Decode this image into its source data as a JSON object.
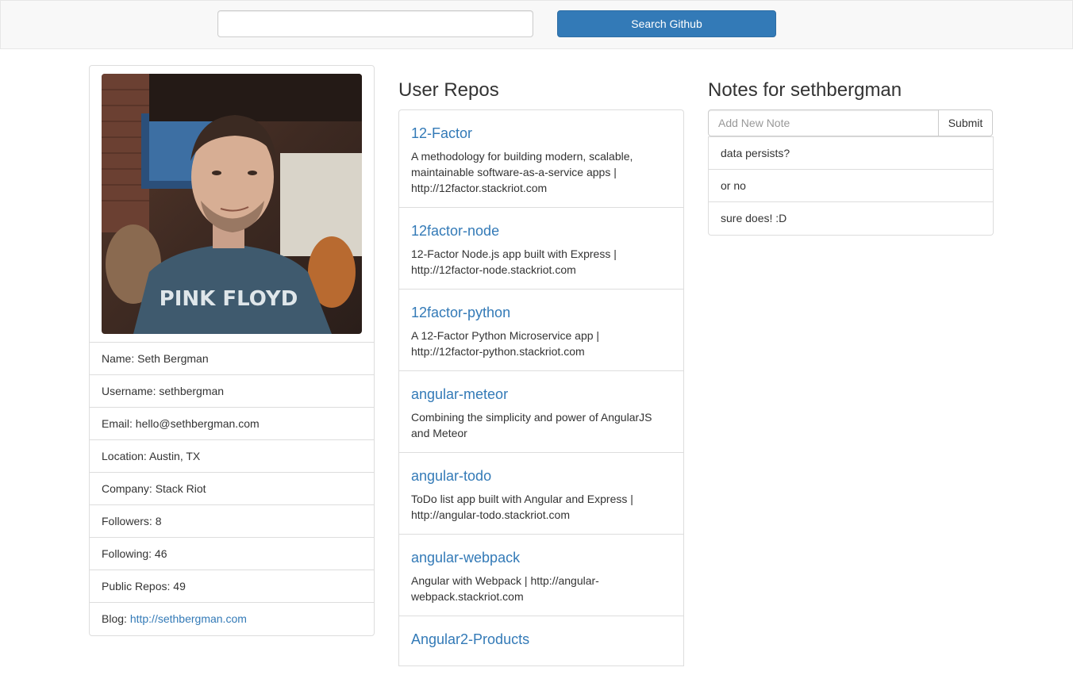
{
  "search": {
    "value": "",
    "placeholder": "",
    "button_label": "Search Github"
  },
  "profile": {
    "avatar_alt": "Seth Bergman avatar",
    "items": [
      {
        "label": "Name: ",
        "value": "Seth Bergman"
      },
      {
        "label": "Username: ",
        "value": "sethbergman"
      },
      {
        "label": "Email: ",
        "value": "hello@sethbergman.com"
      },
      {
        "label": "Location: ",
        "value": "Austin, TX"
      },
      {
        "label": "Company: ",
        "value": "Stack Riot"
      },
      {
        "label": "Followers: ",
        "value": "8"
      },
      {
        "label": "Following: ",
        "value": "46"
      },
      {
        "label": "Public Repos: ",
        "value": "49"
      }
    ],
    "blog_label": "Blog: ",
    "blog_url": "http://sethbergman.com"
  },
  "repos": {
    "title": "User Repos",
    "items": [
      {
        "name": "12-Factor",
        "description": "A methodology for building modern, scalable, maintainable software-as-a-service apps | http://12factor.stackriot.com"
      },
      {
        "name": "12factor-node",
        "description": "12-Factor Node.js app built with Express | http://12factor-node.stackriot.com"
      },
      {
        "name": "12factor-python",
        "description": "A 12-Factor Python Microservice app | http://12factor-python.stackriot.com"
      },
      {
        "name": "angular-meteor",
        "description": "Combining the simplicity and power of AngularJS and Meteor"
      },
      {
        "name": "angular-todo",
        "description": "ToDo list app built with Angular and Express | http://angular-todo.stackriot.com"
      },
      {
        "name": "angular-webpack",
        "description": "Angular with Webpack | http://angular-webpack.stackriot.com"
      },
      {
        "name": "Angular2-Products",
        "description": ""
      }
    ]
  },
  "notes": {
    "title": "Notes for sethbergman",
    "input_placeholder": "Add New Note",
    "submit_label": "Submit",
    "items": [
      "data persists?",
      "or no",
      "sure does! :D"
    ]
  },
  "colors": {
    "primary": "#337ab7",
    "border": "#dddddd",
    "navbar_bg": "#f8f8f8"
  }
}
